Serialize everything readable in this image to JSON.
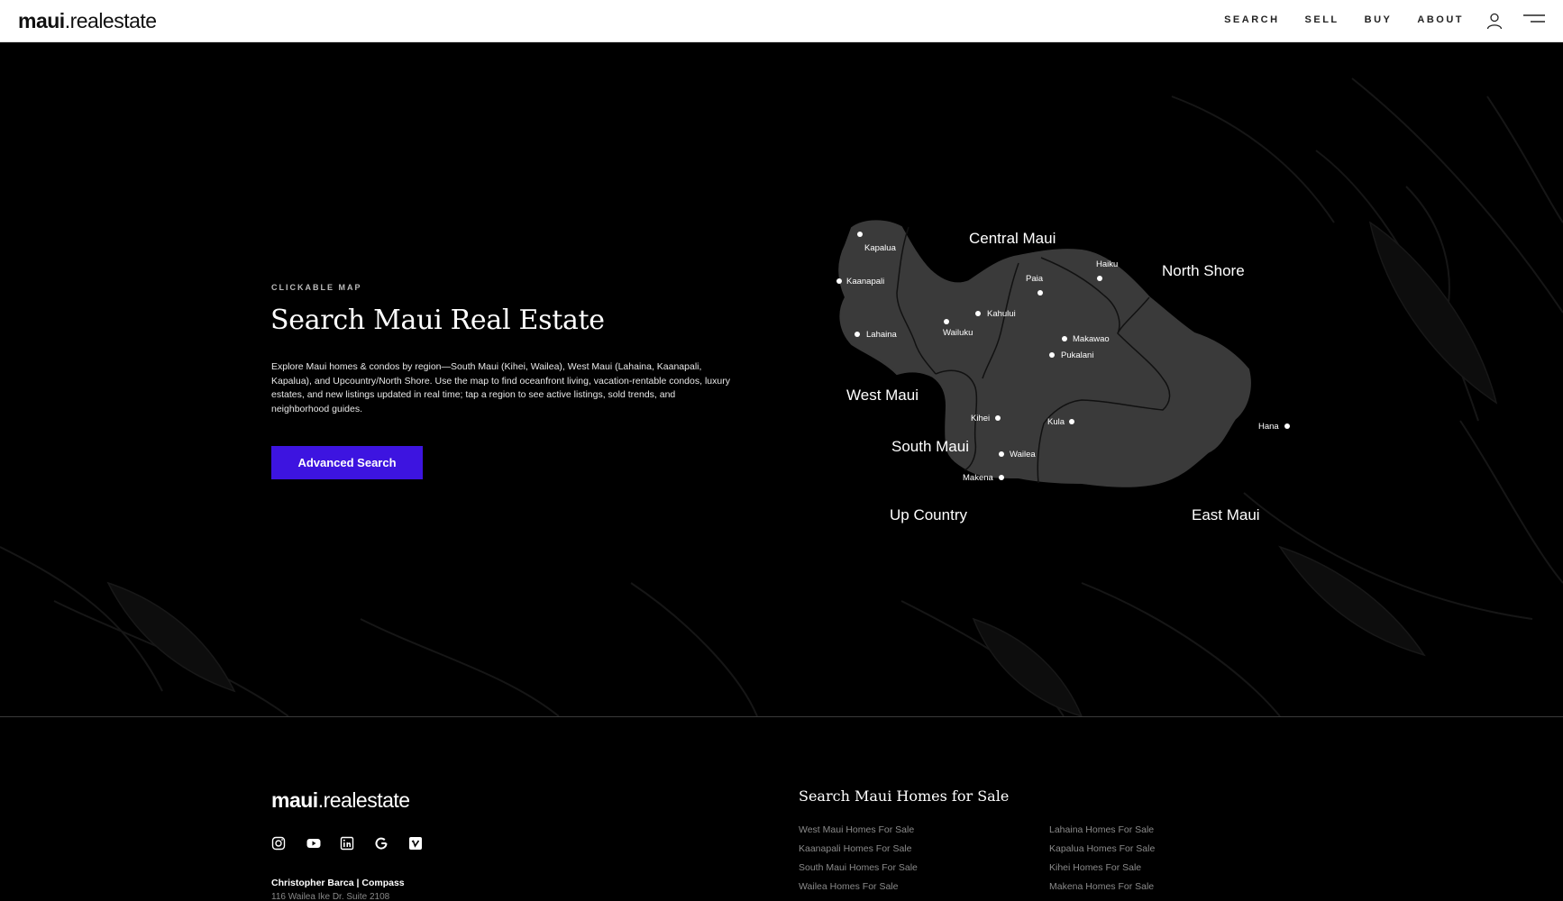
{
  "header": {
    "logo_bold": "maui",
    "logo_rest": ".realestate",
    "nav": [
      "SEARCH",
      "SELL",
      "BUY",
      "ABOUT"
    ],
    "icons": [
      "user-icon",
      "menu-icon"
    ]
  },
  "hero": {
    "eyebrow": "CLICKABLE MAP",
    "title": "Search Maui Real Estate",
    "description": "Explore Maui homes & condos by region—South Maui (Kihei, Wailea), West Maui (Lahaina, Kaanapali, Kapalua), and Upcountry/North Shore. Use the map to find oceanfront living, vacation-rentable condos, luxury estates, and new listings updated in real time; tap a region to see active listings, sold trends, and neighborhood guides.",
    "button": "Advanced Search"
  },
  "map": {
    "regions": [
      "Central Maui",
      "North Shore",
      "West Maui",
      "South Maui",
      "Up Country",
      "East Maui"
    ],
    "towns": [
      "Kapalua",
      "Kaanapali",
      "Lahaina",
      "Wailuku",
      "Kahului",
      "Paia",
      "Haiku",
      "Makawao",
      "Pukalani",
      "Kihei",
      "Kula",
      "Wailea",
      "Makena",
      "Hana"
    ],
    "land_color": "#3a3a3a",
    "line_color": "#111111"
  },
  "footer": {
    "logo_bold": "maui",
    "logo_rest": ".realestate",
    "socials": [
      "instagram-icon",
      "youtube-icon",
      "linkedin-icon",
      "google-icon",
      "vimeo-icon"
    ],
    "company": "Christopher Barca | Compass",
    "address": "116 Wailea Ike Dr. Suite 2108",
    "heading": "Search Maui Homes for Sale",
    "col1": [
      "West Maui Homes For Sale",
      "Kaanapali Homes For Sale",
      "South Maui Homes For Sale",
      "Wailea Homes For Sale"
    ],
    "col2": [
      "Lahaina Homes For Sale",
      "Kapalua Homes For Sale",
      "Kihei Homes For Sale",
      "Makena Homes For Sale"
    ]
  },
  "colors": {
    "accent": "#3d14e0",
    "background": "#000000",
    "header_bg": "#ffffff"
  }
}
